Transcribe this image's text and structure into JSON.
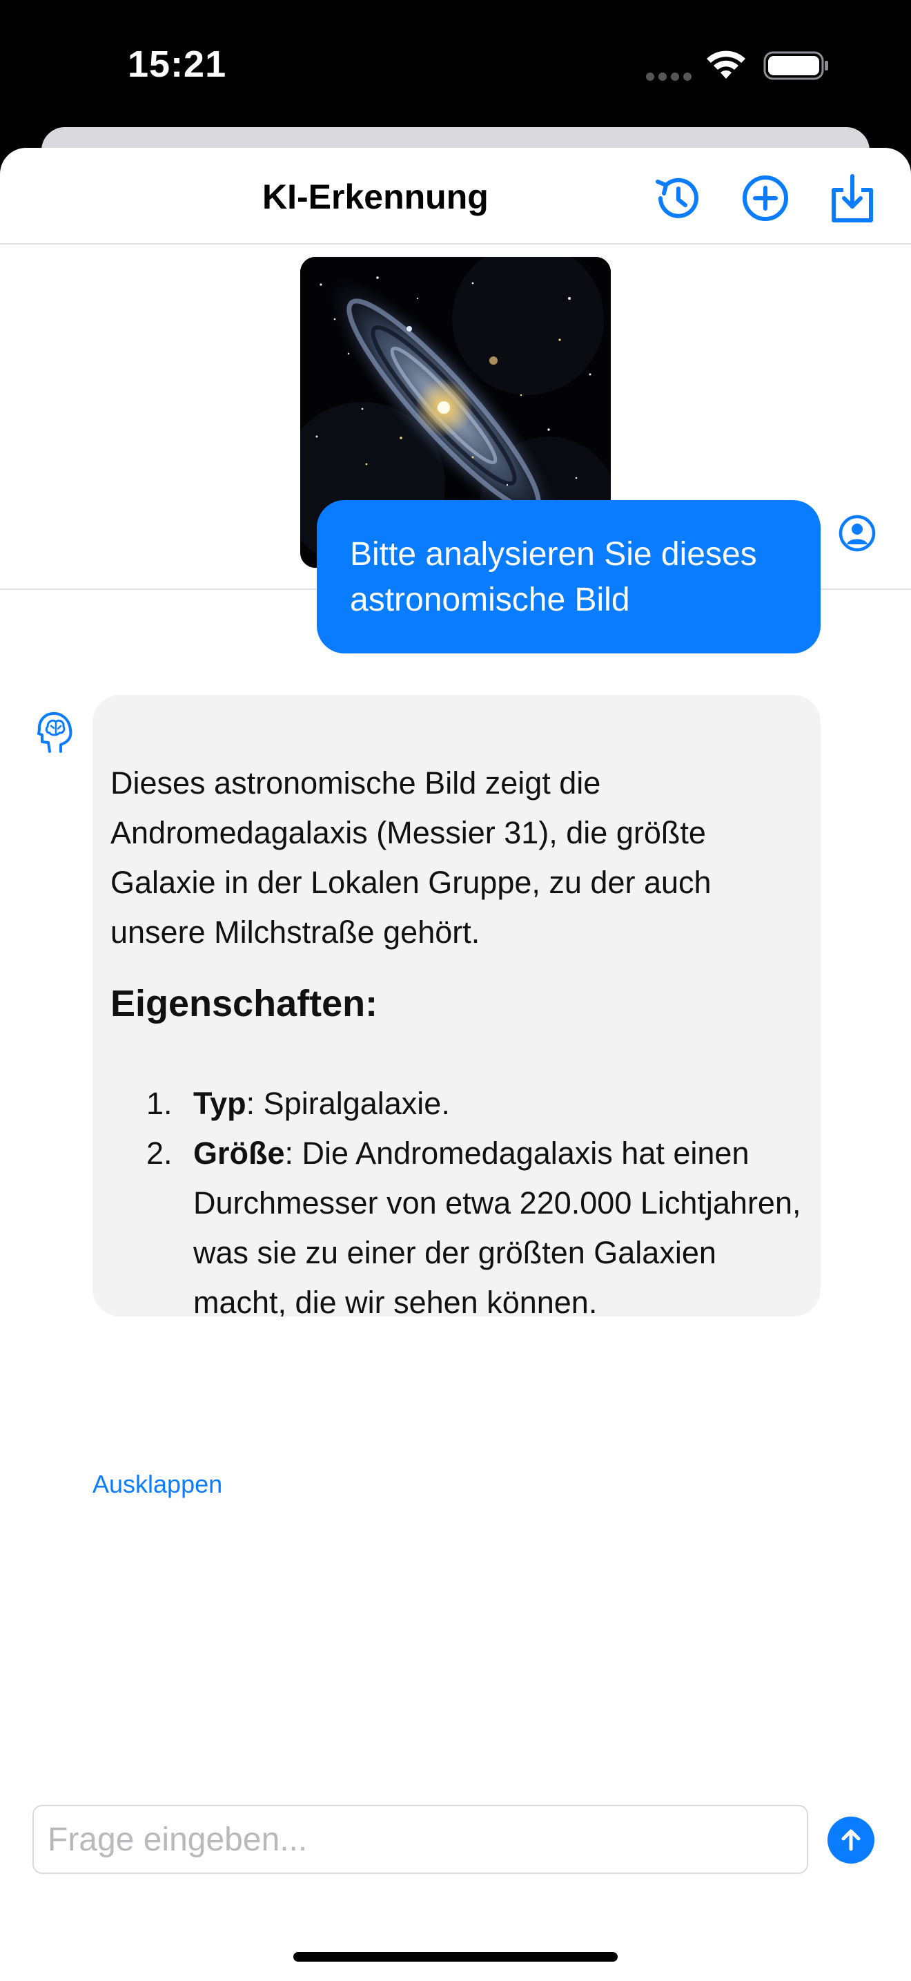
{
  "status_bar": {
    "time": "15:21"
  },
  "nav": {
    "title": "KI-Erkennung",
    "icons": [
      "history-icon",
      "add-circle-icon",
      "download-tray-icon"
    ]
  },
  "chat": {
    "user_message": "Bitte analysieren Sie dieses astronomische Bild",
    "ai_message": {
      "intro": "Dieses astronomische Bild zeigt die Andromedagalaxis (Messier 31), die größte Galaxie in der Lokalen Gruppe, zu der auch unsere Milchstraße gehört.",
      "heading": "Eigenschaften:",
      "items": [
        {
          "number": "1.",
          "label": "Typ",
          "text": ": Spiralgalaxie."
        },
        {
          "number": "2.",
          "label": "Größe",
          "text": ": Die Andromedagalaxis hat einen Durchmesser von etwa 220.000 Lichtjahren, was sie zu einer der größten Galaxien macht, die wir sehen können."
        }
      ]
    },
    "expand_label": "Ausklappen"
  },
  "input": {
    "placeholder": "Frage eingeben..."
  },
  "colors": {
    "accent": "#0a7cff",
    "ai_bubble": "#f3f3f3"
  }
}
